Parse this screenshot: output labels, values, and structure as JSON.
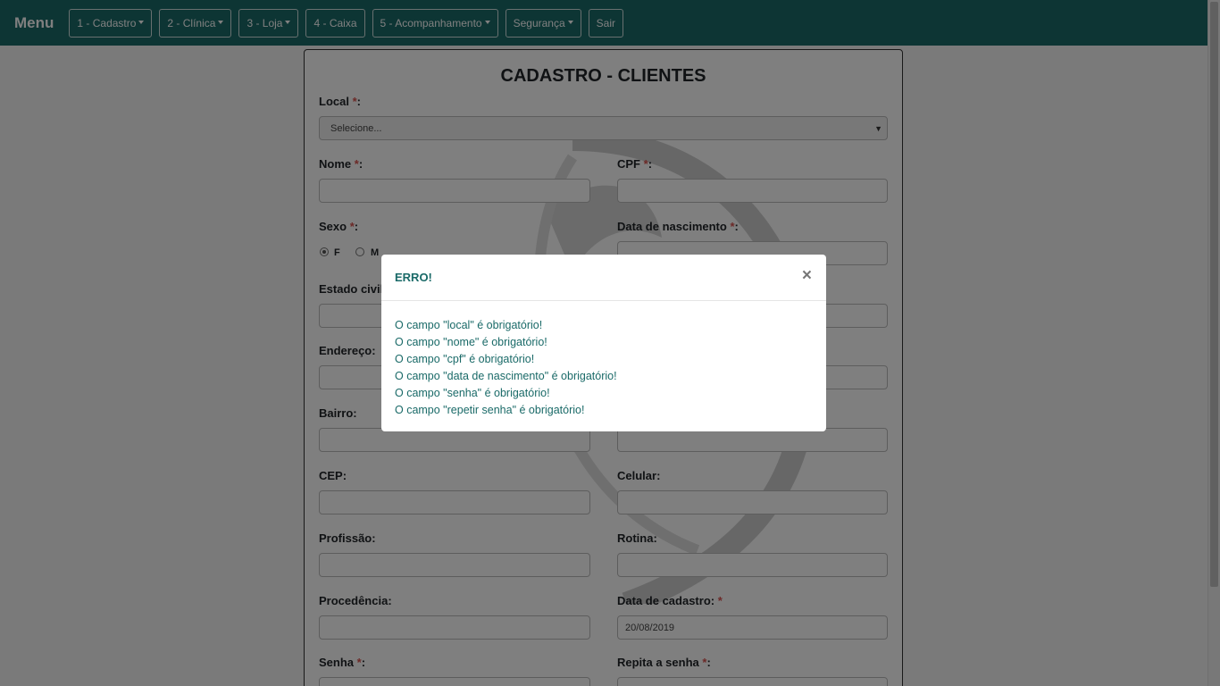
{
  "nav": {
    "brand": "Menu",
    "items": [
      {
        "label": "1 - Cadastro",
        "dropdown": true
      },
      {
        "label": "2 - Clínica",
        "dropdown": true
      },
      {
        "label": "3 - Loja",
        "dropdown": true
      },
      {
        "label": "4 - Caixa",
        "dropdown": false
      },
      {
        "label": "5 - Acompanhamento",
        "dropdown": true
      },
      {
        "label": "Segurança",
        "dropdown": true
      },
      {
        "label": "Sair",
        "dropdown": false
      }
    ]
  },
  "form": {
    "title": "CADASTRO - CLIENTES",
    "required_mark": "*",
    "local": {
      "label": "Local",
      "value": "Selecione..."
    },
    "nome": {
      "label": "Nome",
      "value": ""
    },
    "cpf": {
      "label": "CPF",
      "value": ""
    },
    "sexo": {
      "label": "Sexo",
      "options": [
        "F",
        "M"
      ],
      "selected": "F"
    },
    "data_nascimento": {
      "label": "Data de nascimento",
      "value": ""
    },
    "estado_civil": {
      "label": "Estado civil"
    },
    "endereco": {
      "label": "Endereço:"
    },
    "bairro": {
      "label": "Bairro:"
    },
    "cep": {
      "label": "CEP:"
    },
    "celular": {
      "label": "Celular:"
    },
    "profissao": {
      "label": "Profissão:"
    },
    "rotina": {
      "label": "Rotina:"
    },
    "procedencia": {
      "label": "Procedência:"
    },
    "data_cadastro": {
      "label": "Data de cadastro:",
      "value": "20/08/2019"
    },
    "senha": {
      "label": "Senha"
    },
    "repita_senha": {
      "label": "Repita a senha"
    }
  },
  "modal": {
    "title": "ERRO!",
    "close": "×",
    "messages": [
      "O campo \"local\" é obrigatório!",
      "O campo \"nome\" é obrigatório!",
      "O campo \"cpf\" é obrigatório!",
      "O campo \"data de nascimento\" é obrigatório!",
      "O campo \"senha\" é obrigatório!",
      "O campo \"repetir senha\" é obrigatório!"
    ]
  },
  "colors": {
    "navbar": "#1a6a68",
    "required": "#d9534f",
    "modal_text": "#1a6a68"
  }
}
